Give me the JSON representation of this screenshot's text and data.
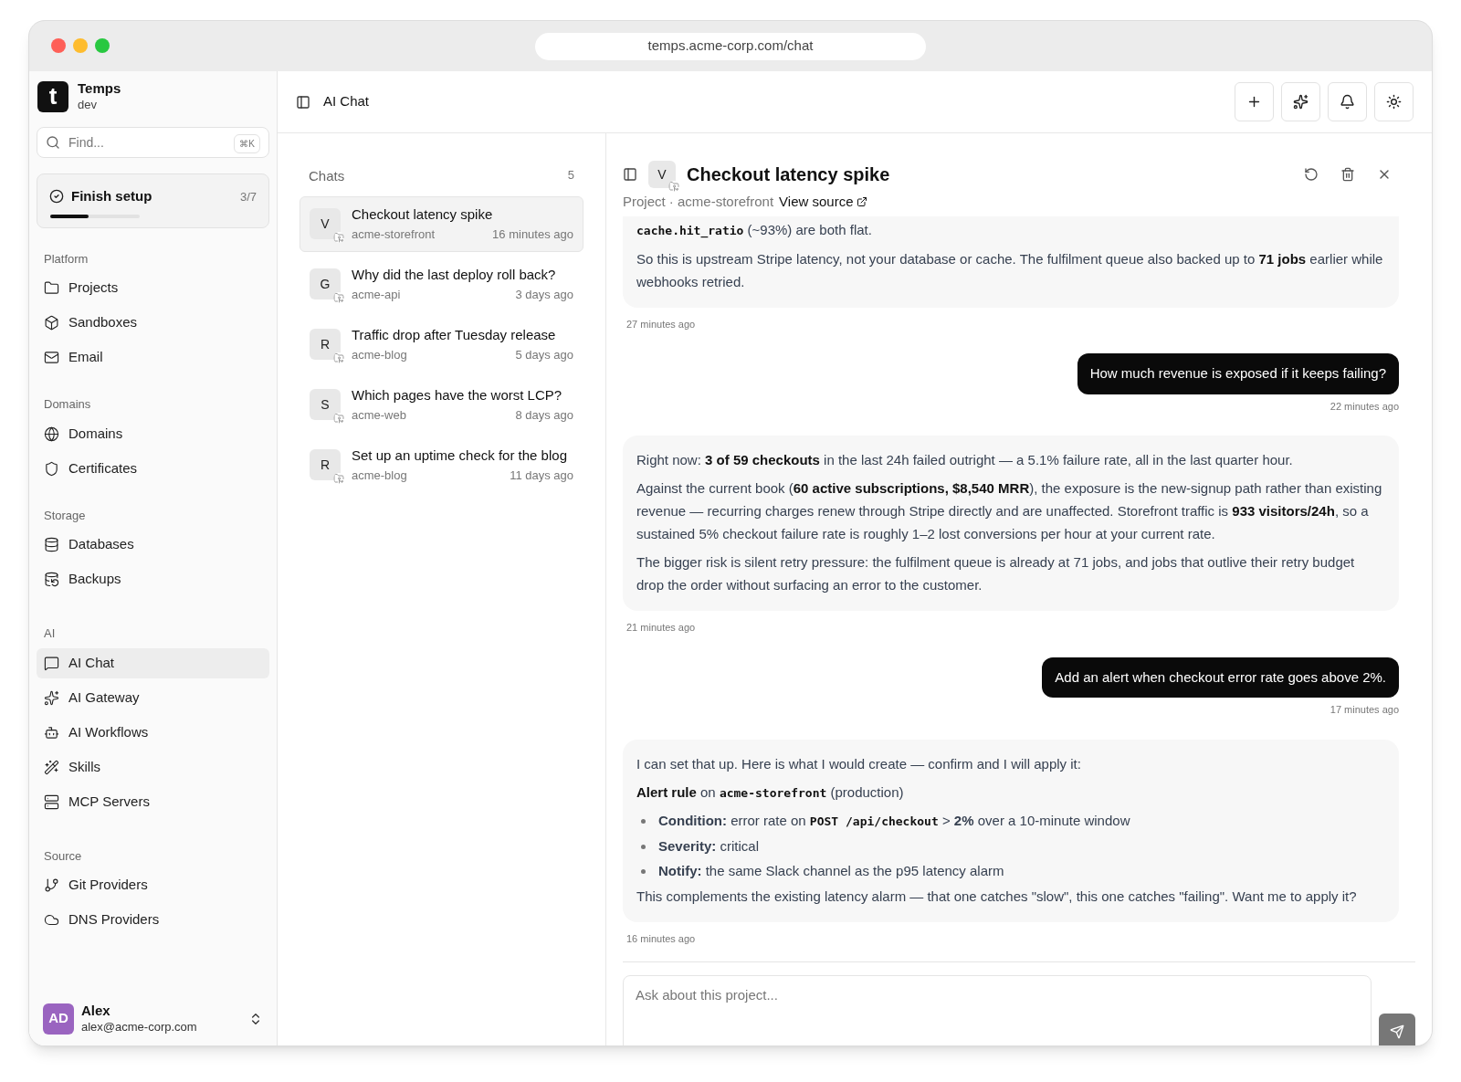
{
  "browser": {
    "url": "temps.acme-corp.com/chat"
  },
  "workspace": {
    "logo": "t",
    "name": "Temps",
    "env": "dev"
  },
  "search": {
    "placeholder": "Find...",
    "shortcut": "⌘K"
  },
  "setup": {
    "label": "Finish setup",
    "count": "3/7",
    "level": 0.43
  },
  "nav": [
    {
      "heading": "Platform",
      "items": [
        {
          "label": "Projects",
          "selected": false
        },
        {
          "label": "Sandboxes",
          "selected": false
        },
        {
          "label": "Email",
          "selected": false
        }
      ]
    },
    {
      "heading": "Domains",
      "items": [
        {
          "label": "Domains",
          "selected": false
        },
        {
          "label": "Certificates",
          "selected": false
        }
      ]
    },
    {
      "heading": "Storage",
      "items": [
        {
          "label": "Databases",
          "selected": false
        },
        {
          "label": "Backups",
          "selected": false
        }
      ]
    },
    {
      "heading": "AI",
      "items": [
        {
          "label": "AI Chat",
          "selected": true
        },
        {
          "label": "AI Gateway",
          "selected": false
        },
        {
          "label": "AI Workflows",
          "selected": false
        },
        {
          "label": "Skills",
          "selected": false
        },
        {
          "label": "MCP Servers",
          "selected": false
        }
      ]
    },
    {
      "heading": "Source",
      "items": [
        {
          "label": "Git Providers",
          "selected": false
        },
        {
          "label": "DNS Providers",
          "selected": false
        }
      ]
    }
  ],
  "user": {
    "initials": "AD",
    "name": "Alex",
    "email": "alex@acme-corp.com"
  },
  "header": {
    "title": "AI Chat"
  },
  "chats": {
    "title": "Chats",
    "count": "5",
    "items": [
      {
        "avatar": "V",
        "title": "Checkout latency spike",
        "project": "acme-storefront",
        "time": "16 minutes ago",
        "selected": true
      },
      {
        "avatar": "G",
        "title": "Why did the last deploy roll back?",
        "project": "acme-api",
        "time": "3 days ago",
        "selected": false
      },
      {
        "avatar": "R",
        "title": "Traffic drop after Tuesday release",
        "project": "acme-blog",
        "time": "5 days ago",
        "selected": false
      },
      {
        "avatar": "S",
        "title": "Which pages have the worst LCP?",
        "project": "acme-web",
        "time": "8 days ago",
        "selected": false
      },
      {
        "avatar": "R",
        "title": "Set up an uptime check for the blog",
        "project": "acme-blog",
        "time": "11 days ago",
        "selected": false
      }
    ]
  },
  "conversation": {
    "avatar": "V",
    "title": "Checkout latency spike",
    "project_label": "Project · acme-storefront",
    "source_link": "View source",
    "messages": [
      {
        "kind": "assistant",
        "time": "27 minutes ago",
        "blocks": [
          {
            "kind": "paragraph",
            "parts": [
              {
                "kind": "code",
                "text": "cache.hit_ratio"
              },
              {
                "kind": "text",
                "text": " (~93%) are both flat."
              }
            ]
          },
          {
            "kind": "paragraph",
            "parts": [
              {
                "kind": "text",
                "text": "So this is upstream Stripe latency, not your database or cache. The fulfilment queue also backed up to **71 jobs** earlier while webhooks retried."
              }
            ]
          }
        ]
      },
      {
        "kind": "user",
        "time": "22 minutes ago",
        "text": "How much revenue is exposed if it keeps failing?"
      },
      {
        "kind": "assistant",
        "time": "21 minutes ago",
        "blocks": [
          {
            "kind": "paragraph",
            "parts": [
              {
                "kind": "text",
                "text": "Right now: **3 of 59 checkouts** in the last 24h failed outright — a 5.1% failure rate, all in the last quarter hour."
              }
            ]
          },
          {
            "kind": "paragraph",
            "parts": [
              {
                "kind": "text",
                "text": "Against the current book (**60 active subscriptions, $8,540 MRR**), the exposure is the new-signup path rather than existing revenue — recurring charges renew through Stripe directly and are unaffected. Storefront traffic is **933 visitors/24h**, so a sustained 5% checkout failure rate is roughly 1–2 lost conversions per hour at your current rate."
              }
            ]
          },
          {
            "kind": "paragraph",
            "parts": [
              {
                "kind": "text",
                "text": "The bigger risk is silent retry pressure: the fulfilment queue is already at 71 jobs, and jobs that outlive their retry budget drop the order without surfacing an error to the customer."
              }
            ]
          }
        ]
      },
      {
        "kind": "user",
        "time": "17 minutes ago",
        "text": "Add an alert when checkout error rate goes above 2%."
      },
      {
        "kind": "assistant",
        "time": "16 minutes ago",
        "blocks": [
          {
            "kind": "paragraph",
            "parts": [
              {
                "kind": "text",
                "text": "I can set that up. Here is what I would create — confirm and I will apply it:"
              }
            ]
          },
          {
            "kind": "paragraph",
            "parts": [
              {
                "kind": "text",
                "text": "**Alert rule** on "
              },
              {
                "kind": "code",
                "text": "acme-storefront"
              },
              {
                "kind": "text",
                "text": " (production)"
              }
            ]
          },
          {
            "kind": "bullet",
            "parts": [
              {
                "kind": "text",
                "text": "**Condition:** error rate on "
              },
              {
                "kind": "code",
                "text": "POST /api/checkout"
              },
              {
                "kind": "text",
                "text": " > **2%** over a 10-minute window"
              }
            ]
          },
          {
            "kind": "bullet",
            "parts": [
              {
                "kind": "text",
                "text": "**Severity:** critical"
              }
            ]
          },
          {
            "kind": "bullet",
            "parts": [
              {
                "kind": "text",
                "text": "**Notify:** the same Slack channel as the p95 latency alarm"
              }
            ]
          },
          {
            "kind": "paragraph",
            "parts": [
              {
                "kind": "text",
                "text": "This complements the existing latency alarm — that one catches \"slow\", this one catches \"failing\". Want me to apply it?"
              }
            ]
          }
        ]
      }
    ],
    "input": {
      "placeholder": "Ask about this project..."
    }
  }
}
